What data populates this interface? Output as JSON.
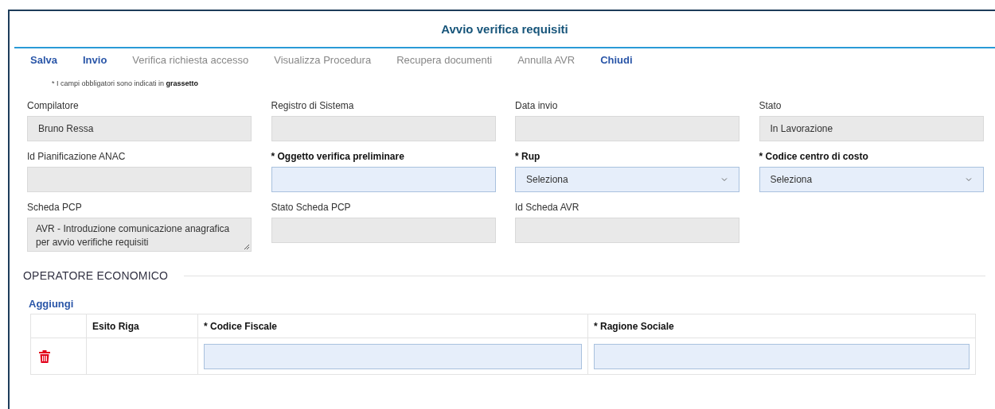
{
  "window": {
    "title": "Avvio verifica requisiti"
  },
  "toolbar": [
    {
      "label": "Salva",
      "disabled": false
    },
    {
      "label": "Invio",
      "disabled": false
    },
    {
      "label": "Verifica richiesta accesso",
      "disabled": true
    },
    {
      "label": "Visualizza Procedura",
      "disabled": true
    },
    {
      "label": "Recupera documenti",
      "disabled": true
    },
    {
      "label": "Annulla AVR",
      "disabled": true
    },
    {
      "label": "Chiudi",
      "disabled": false
    }
  ],
  "note": "* I campi obbligatori sono indicati in **grassetto**",
  "fields": [
    {
      "label": "Compilatore",
      "kind": "text",
      "required": false,
      "readonly": true,
      "value": "Bruno Ressa"
    },
    {
      "label": "Registro di Sistema",
      "kind": "text",
      "required": false,
      "readonly": true
    },
    {
      "label": "Data invio",
      "kind": "text",
      "required": false,
      "readonly": true
    },
    {
      "label": "Stato",
      "kind": "text",
      "required": false,
      "readonly": true,
      "value": "In Lavorazione"
    },
    {
      "label": "Id Pianificazione ANAC",
      "kind": "text",
      "required": false,
      "readonly": true
    },
    {
      "label": "* Oggetto verifica preliminare",
      "kind": "text",
      "required": true,
      "readonly": false
    },
    {
      "label": "* Rup",
      "kind": "select",
      "required": true,
      "readonly": false,
      "value": "Seleziona"
    },
    {
      "label": "* Codice centro di costo",
      "kind": "select",
      "required": true,
      "readonly": false,
      "value": "Seleziona"
    },
    {
      "label": "Scheda PCP",
      "kind": "textarea",
      "required": false,
      "readonly": true,
      "value": "AVR - Introduzione comunicazione anagrafica per avvio verifiche requisiti"
    },
    {
      "label": "Stato Scheda PCP",
      "kind": "text",
      "required": false,
      "readonly": true
    },
    {
      "label": "Id Scheda AVR",
      "kind": "text",
      "required": false,
      "readonly": true
    }
  ],
  "section": {
    "title": "OPERATORE ECONOMICO",
    "add_link": "Aggiungi",
    "table": {
      "columns": [
        "Esito Riga",
        "* Codice Fiscale",
        "* Ragione Sociale"
      ],
      "rows": [
        {
          "readonly": false
        }
      ]
    }
  }
}
